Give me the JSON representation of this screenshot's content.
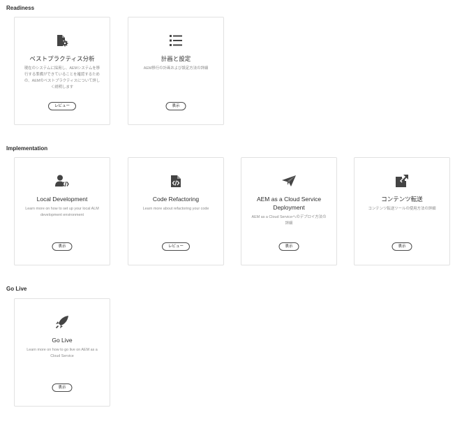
{
  "sections": {
    "readiness": "Readiness",
    "implementation": "Implementation",
    "golive": "Go Live"
  },
  "cards": {
    "best_practices": {
      "icon": "document-gear-icon",
      "title": "ベストプラクティス分析",
      "desc": "現在のシステムに採用し、AEMシステムを移行する準備ができていることを確認するための、AEMのベストプラクティスについて詳しく説明します",
      "button": "レビュー"
    },
    "planning": {
      "icon": "list-icon",
      "title": "計画と設定",
      "desc": "AEM移行の計画および設定方法の詳細",
      "button": "表示"
    },
    "local_dev": {
      "icon": "developer-user-icon",
      "title": "Local Development",
      "desc": "Learn more on how to set up your local ALM development environment",
      "button": "表示"
    },
    "code_refactoring": {
      "icon": "code-file-icon",
      "title": "Code Refactoring",
      "desc": "Learn more about refactoring your code",
      "button": "レビュー"
    },
    "aem_cloud": {
      "icon": "paper-plane-icon",
      "title": "AEM as a Cloud Service Deployment",
      "desc": "AEM as a Cloud Serviceへのデプロイ方法の詳細",
      "button": "表示"
    },
    "content_migration": {
      "icon": "external-edit-icon",
      "title": "コンテンツ転送",
      "desc": "コンテンツ転送ツールの使用方法の詳細",
      "button": "表示"
    },
    "go_live": {
      "icon": "rocket-launch-icon",
      "title": "Go Live",
      "desc": "Learn more on how to go live on AEM as a Cloud Service",
      "button": "表示"
    }
  }
}
